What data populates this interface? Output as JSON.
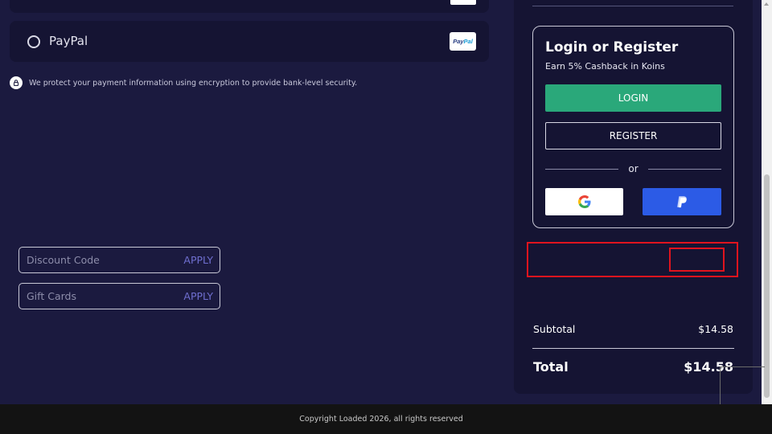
{
  "payment": {
    "paypal_label": "PayPal",
    "paypal_logo_text_a": "Pay",
    "paypal_logo_text_b": "Pal",
    "security_text": "We protect your payment information using encryption to provide bank-level security."
  },
  "login": {
    "title": "Login or Register",
    "subtitle": "Earn 5% Cashback in Koins",
    "login_label": "LOGIN",
    "register_label": "REGISTER",
    "or_text": "or",
    "google_icon": "google-icon",
    "paypal_icon": "paypal-icon"
  },
  "discount": {
    "placeholder": "Discount Code",
    "apply_label": "APPLY"
  },
  "gift": {
    "placeholder": "Gift Cards",
    "apply_label": "APPLY"
  },
  "summary": {
    "subtotal_label": "Subtotal",
    "subtotal_value": "$14.58",
    "total_label": "Total",
    "total_value": "$14.58"
  },
  "footer": {
    "copyright": "Copyright Loaded 2026, all rights reserved"
  },
  "colors": {
    "background": "#1b1a3f",
    "panel": "#151433",
    "login_button": "#2aa87a",
    "paypal_button": "#2c5be6",
    "apply_text": "#6f6fd0",
    "highlight": "#e0141e"
  }
}
